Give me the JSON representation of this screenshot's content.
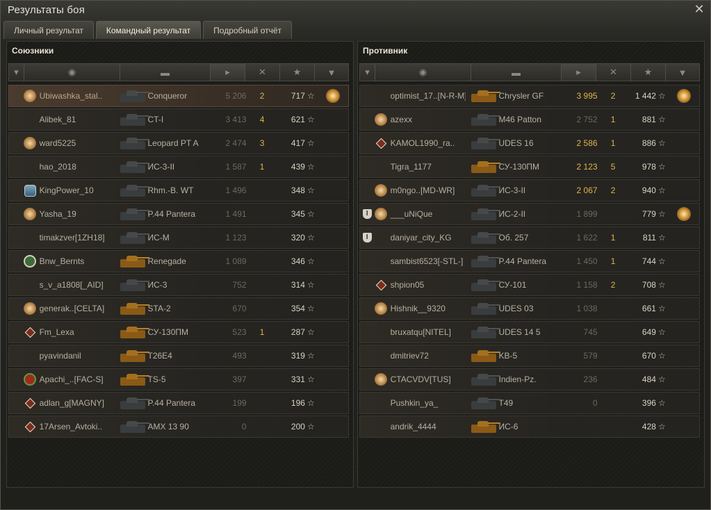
{
  "window": {
    "title": "Результаты боя"
  },
  "tabs": [
    {
      "label": "Личный результат"
    },
    {
      "label": "Командный результат",
      "active": true
    },
    {
      "label": "Подробный отчёт"
    }
  ],
  "allies": {
    "title": "Союзники",
    "rows": [
      {
        "name": "Ubiwashka_stal..",
        "vehicle": "Conqueror",
        "damage": "5 206",
        "kills": "2",
        "xp": "717",
        "badge": "star8",
        "medal": true,
        "me": true,
        "gold": false
      },
      {
        "name": "Alibek_81",
        "vehicle": "CT-I",
        "damage": "3 413",
        "kills": "4",
        "xp": "621",
        "badge": "",
        "medal": false,
        "gold": false
      },
      {
        "name": "ward5225",
        "vehicle": "Leopard PT A",
        "damage": "2 474",
        "kills": "3",
        "xp": "417",
        "badge": "star8",
        "medal": false,
        "gold": false
      },
      {
        "name": "hao_2018",
        "vehicle": "ИС-3-II",
        "damage": "1 587",
        "kills": "1",
        "xp": "439",
        "badge": "",
        "medal": false,
        "gold": false
      },
      {
        "name": "KingPower_10",
        "vehicle": "Rhm.-B. WT",
        "damage": "1 496",
        "kills": "",
        "xp": "348",
        "badge": "clan",
        "medal": false,
        "gold": false
      },
      {
        "name": "Yasha_19",
        "vehicle": "P.44 Pantera",
        "damage": "1 491",
        "kills": "",
        "xp": "345",
        "badge": "star8",
        "medal": false,
        "gold": false
      },
      {
        "name": "timakzver[1ZH18]",
        "vehicle": "ИС-М",
        "damage": "1 123",
        "kills": "",
        "xp": "320",
        "badge": "",
        "medal": false,
        "gold": false
      },
      {
        "name": "Bnw_Bernts",
        "vehicle": "Renegade",
        "damage": "1 089",
        "kills": "",
        "xp": "346",
        "badge": "green",
        "medal": false,
        "gold": true
      },
      {
        "name": "s_v_a1808[_AID]",
        "vehicle": "ИС-3",
        "damage": "752",
        "kills": "",
        "xp": "314",
        "badge": "",
        "medal": false,
        "gold": false
      },
      {
        "name": "generak..[CELTA]",
        "vehicle": "STA-2",
        "damage": "670",
        "kills": "",
        "xp": "354",
        "badge": "star8",
        "medal": false,
        "gold": true
      },
      {
        "name": "Fm_Lexa",
        "vehicle": "СУ-130ПМ",
        "damage": "523",
        "kills": "1",
        "xp": "287",
        "badge": "diam",
        "medal": false,
        "gold": true
      },
      {
        "name": "pyavindanil",
        "vehicle": "T26E4",
        "damage": "493",
        "kills": "",
        "xp": "319",
        "badge": "",
        "medal": false,
        "gold": true
      },
      {
        "name": "Apachi_..[FAC-S]",
        "vehicle": "TS-5",
        "damage": "397",
        "kills": "",
        "xp": "331",
        "badge": "red",
        "medal": false,
        "gold": true
      },
      {
        "name": "adlan_g[MAGNY]",
        "vehicle": "P.44 Pantera",
        "damage": "199",
        "kills": "",
        "xp": "196",
        "badge": "diam",
        "medal": false,
        "gold": false
      },
      {
        "name": "17Arsen_Avtoki..",
        "vehicle": "AMX 13 90",
        "damage": "0",
        "kills": "",
        "xp": "200",
        "badge": "diam",
        "medal": false,
        "gold": false
      }
    ]
  },
  "enemies": {
    "title": "Противник",
    "rows": [
      {
        "name": "optimist_17..[N-R-M]",
        "vehicle": "Chrysler GF",
        "damage": "3 995",
        "kills": "2",
        "xp": "1 442",
        "badge": "",
        "medal": true,
        "gold": true,
        "hi": true
      },
      {
        "name": "azexx",
        "vehicle": "M46 Patton",
        "damage": "2 752",
        "kills": "1",
        "xp": "881",
        "badge": "star8",
        "medal": false,
        "gold": false
      },
      {
        "name": "KAMOL1990_ra..",
        "vehicle": "UDES 16",
        "damage": "2 586",
        "kills": "1",
        "xp": "886",
        "badge": "diam",
        "medal": false,
        "gold": false,
        "hi": true
      },
      {
        "name": "Tigra_1177",
        "vehicle": "СУ-130ПМ",
        "damage": "2 123",
        "kills": "5",
        "xp": "978",
        "badge": "",
        "medal": false,
        "gold": true,
        "hi": true
      },
      {
        "name": "m0ngo..[MD-WR]",
        "vehicle": "ИС-3-II",
        "damage": "2 067",
        "kills": "2",
        "xp": "940",
        "badge": "star8",
        "medal": false,
        "gold": false,
        "hi": true
      },
      {
        "name": "___uNiQue",
        "vehicle": "ИС-2-II",
        "damage": "1 899",
        "kills": "",
        "xp": "779",
        "badge": "star8",
        "squad": "I",
        "medal": true,
        "gold": false
      },
      {
        "name": "daniyar_city_KG",
        "vehicle": "Об. 257",
        "damage": "1 622",
        "kills": "1",
        "xp": "811",
        "badge": "",
        "squad": "I",
        "medal": false,
        "gold": false
      },
      {
        "name": "sambist6523[-STL-]",
        "vehicle": "P.44 Pantera",
        "damage": "1 450",
        "kills": "1",
        "xp": "744",
        "badge": "",
        "medal": false,
        "gold": false
      },
      {
        "name": "shpion05",
        "vehicle": "СУ-101",
        "damage": "1 158",
        "kills": "2",
        "xp": "708",
        "badge": "diam",
        "medal": false,
        "gold": false
      },
      {
        "name": "Hishnik__9320",
        "vehicle": "UDES 03",
        "damage": "1 038",
        "kills": "",
        "xp": "661",
        "badge": "star8",
        "medal": false,
        "gold": false
      },
      {
        "name": "bruxatqu[NITEL]",
        "vehicle": "UDES 14 5",
        "damage": "745",
        "kills": "",
        "xp": "649",
        "badge": "",
        "medal": false,
        "gold": false
      },
      {
        "name": "dmitriev72",
        "vehicle": "KB-5",
        "damage": "579",
        "kills": "",
        "xp": "670",
        "badge": "",
        "medal": false,
        "gold": true
      },
      {
        "name": "CTACVDV[TUS]",
        "vehicle": "Indien-Pz.",
        "damage": "236",
        "kills": "",
        "xp": "484",
        "badge": "star8",
        "medal": false,
        "gold": false
      },
      {
        "name": "Pushkin_ya_",
        "vehicle": "T49",
        "damage": "0",
        "kills": "",
        "xp": "396",
        "badge": "",
        "medal": false,
        "gold": false
      },
      {
        "name": "andrik_4444",
        "vehicle": "ИС-6",
        "damage": "",
        "kills": "",
        "xp": "428",
        "badge": "",
        "medal": false,
        "gold": true
      }
    ]
  },
  "xp_suffix": "☆",
  "header_icons": [
    "squad-icon",
    "player-icon",
    "vehicle-icon",
    "damage-icon",
    "kills-icon",
    "xp-icon",
    "medal-icon"
  ],
  "colors": {
    "accent": "#e0b44a",
    "text": "#c9c3b0"
  }
}
